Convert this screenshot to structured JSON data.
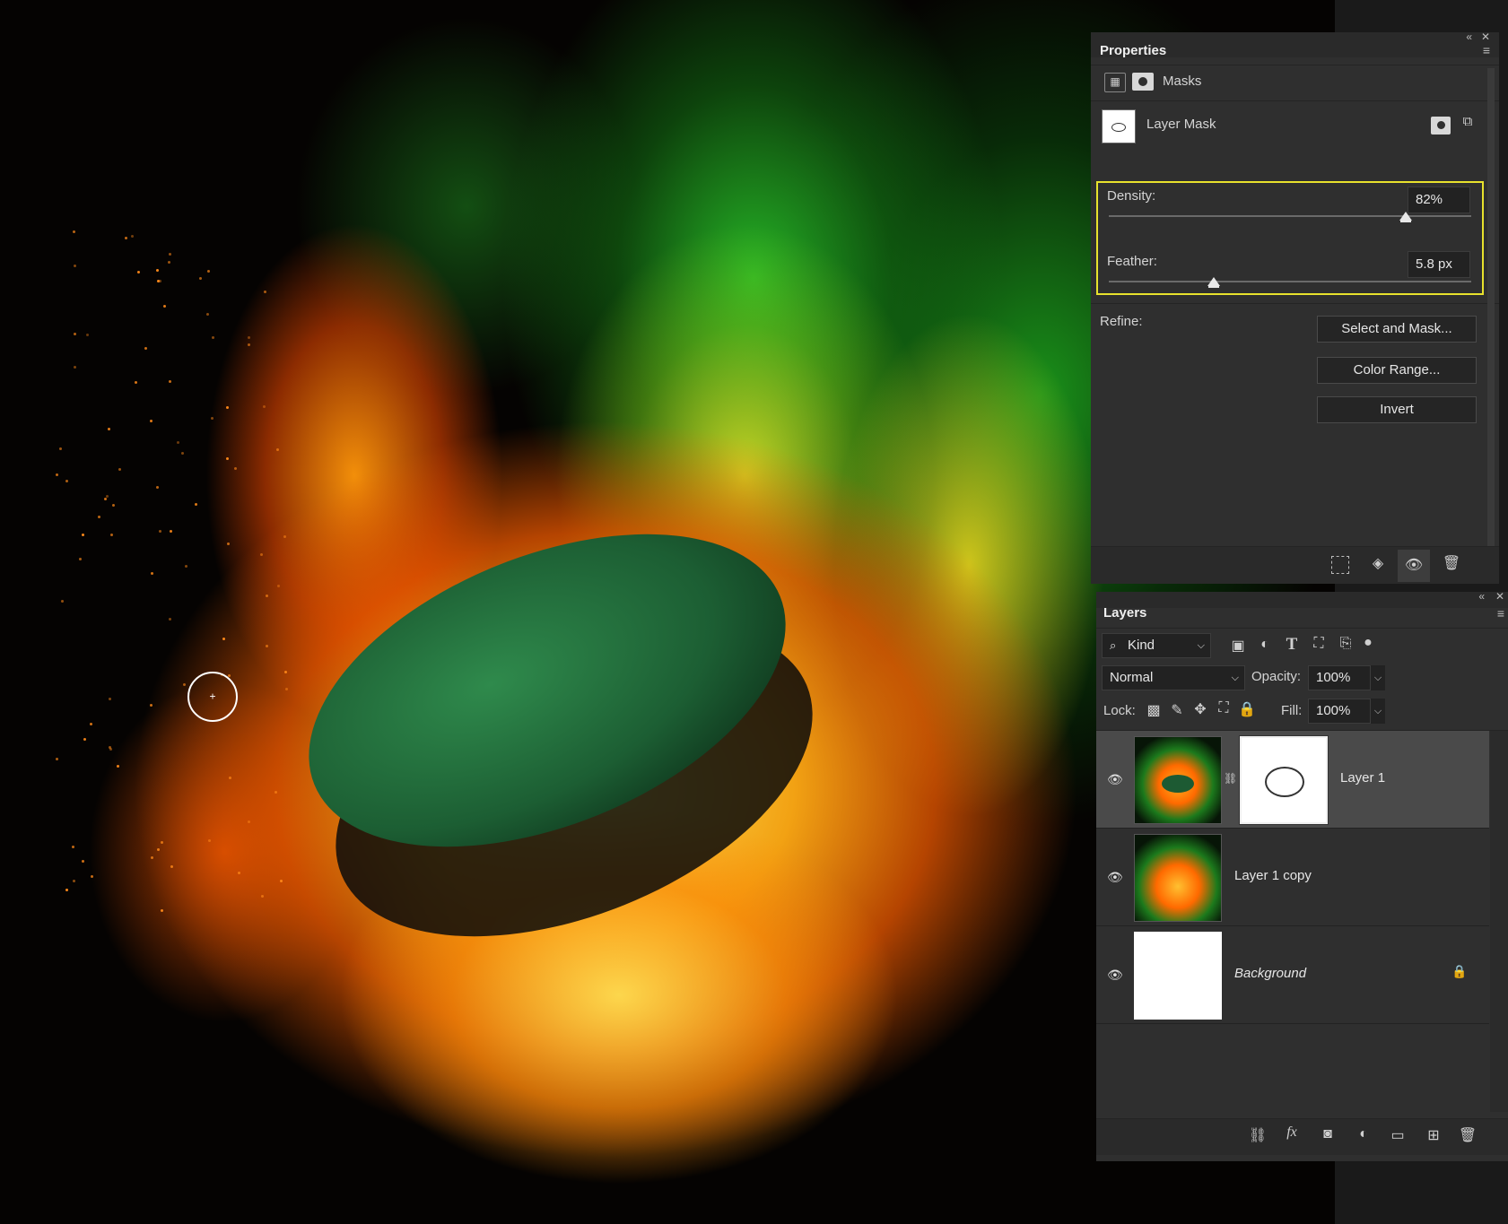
{
  "properties": {
    "title": "Properties",
    "mode_label": "Masks",
    "mask_type_label": "Layer Mask",
    "density": {
      "label": "Density:",
      "value": "82%",
      "percent": 82
    },
    "feather": {
      "label": "Feather:",
      "value": "5.8 px",
      "fraction": 0.29
    },
    "refine_label": "Refine:",
    "buttons": {
      "select_and_mask": "Select and Mask...",
      "color_range": "Color Range...",
      "invert": "Invert"
    }
  },
  "layers_panel": {
    "title": "Layers",
    "filter_kind": "Kind",
    "blend_mode": "Normal",
    "opacity_label": "Opacity:",
    "opacity_value": "100%",
    "lock_label": "Lock:",
    "fill_label": "Fill:",
    "fill_value": "100%",
    "layers": [
      {
        "name": "Layer 1",
        "selected": true,
        "has_mask": true
      },
      {
        "name": "Layer 1 copy",
        "selected": false,
        "has_mask": false
      },
      {
        "name": "Background",
        "selected": false,
        "locked": true
      }
    ]
  },
  "colors": {
    "panel_bg": "#2f2f2f",
    "highlight": "#e8e22d",
    "selected_row": "#4a4a4a"
  },
  "icons": {
    "panel_collapse": "«",
    "panel_close": "✕",
    "panel_menu": "≡",
    "eye": "visibility-icon",
    "lock": "lock-icon"
  }
}
